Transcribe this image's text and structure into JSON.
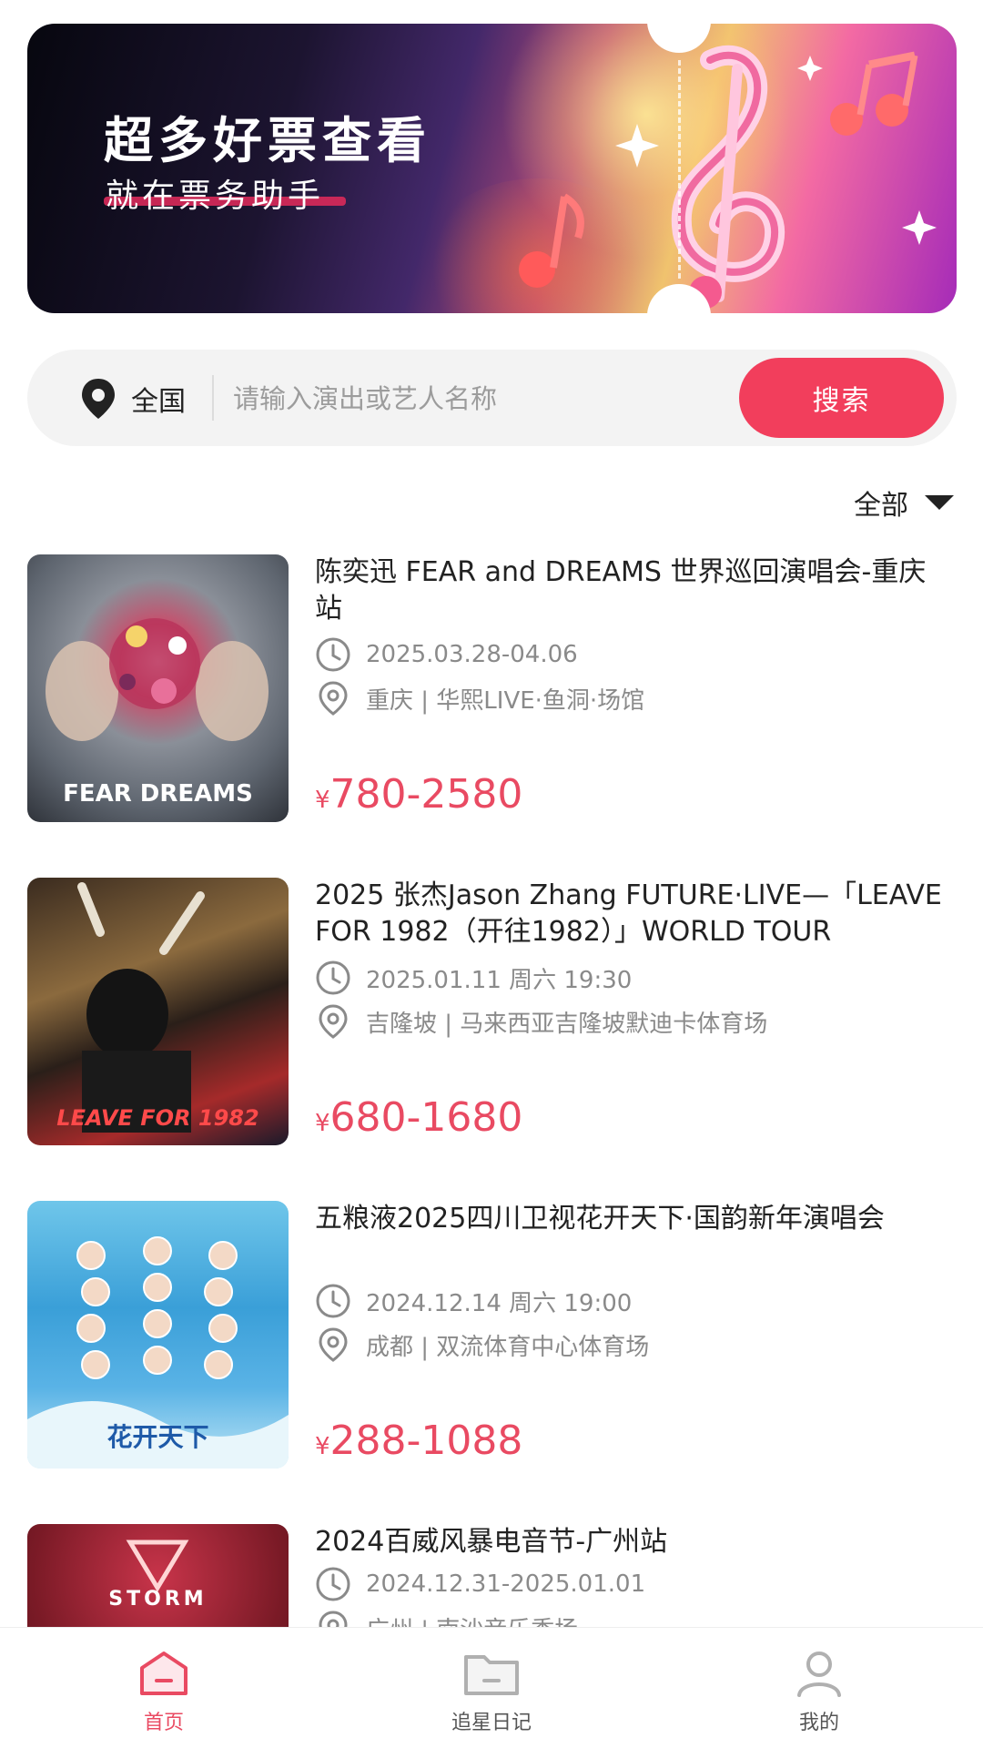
{
  "banner": {
    "title": "超多好票查看",
    "subtitle": "就在票务助手"
  },
  "search": {
    "region": "全国",
    "placeholder": "请输入演出或艺人名称",
    "button_label": "搜索"
  },
  "filter": {
    "selected": "全部"
  },
  "events": [
    {
      "title": "陈奕迅 FEAR and DREAMS 世界巡回演唱会-重庆站",
      "date": "2025.03.28-04.06",
      "venue": "重庆 | 华熙LIVE·鱼洞·场馆",
      "currency": "¥",
      "price": "780-2580",
      "poster_text": "FEAR DREAMS"
    },
    {
      "title": "2025 张杰Jason Zhang FUTURE·LIVE—「LEAVE FOR 1982（开往1982）」WORLD TOUR",
      "date": "2025.01.11 周六 19:30",
      "venue": "吉隆坡 | 马来西亚吉隆坡默迪卡体育场",
      "currency": "¥",
      "price": "680-1680",
      "poster_text": "LEAVE FOR 1982"
    },
    {
      "title": "五粮液2025四川卫视花开天下·国韵新年演唱会",
      "date": "2024.12.14 周六 19:00",
      "venue": "成都 | 双流体育中心体育场",
      "currency": "¥",
      "price": "288-1088",
      "poster_text": "花开天下"
    },
    {
      "title": "2024百威风暴电音节-广州站",
      "date": "2024.12.31-2025.01.01",
      "venue": "广州 | 南沙音乐季场",
      "currency": "¥",
      "price": "",
      "poster_text": "STORM"
    }
  ],
  "tabbar": {
    "items": [
      {
        "label": "首页",
        "icon": "home-icon",
        "active": true
      },
      {
        "label": "追星日记",
        "icon": "folder-icon",
        "active": false
      },
      {
        "label": "我的",
        "icon": "user-icon",
        "active": false
      }
    ]
  },
  "colors": {
    "accent": "#f23e5c",
    "price": "#e94a62",
    "muted": "#8a8a8a"
  }
}
